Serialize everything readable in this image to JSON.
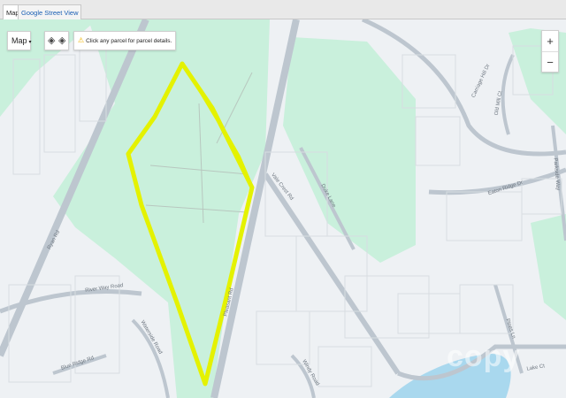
{
  "tabs": [
    {
      "label": "Map",
      "active": true
    },
    {
      "label": "Google Street View",
      "active": false
    }
  ],
  "controls": {
    "map_type_label": "Map",
    "layers_icons": [
      "layer-up-icon",
      "layer-down-icon"
    ],
    "parcel_hint": "Click any parcel for parcel details.",
    "hint_icon": "warning-icon",
    "zoom_in": "+",
    "zoom_out": "−"
  },
  "roads": [
    {
      "name": "Ryan Rd"
    },
    {
      "name": "Pleasant Rd"
    },
    {
      "name": "Vale Crest Rd"
    },
    {
      "name": "River Way Road"
    },
    {
      "name": "Waterside Road"
    },
    {
      "name": "Blue Ridge Rd"
    },
    {
      "name": "Carriage Hill Dr"
    },
    {
      "name": "Eaton Ridge Dr"
    },
    {
      "name": "Old Mill Ct"
    },
    {
      "name": "Parkside Way"
    },
    {
      "name": "Windy Road"
    },
    {
      "name": "Duke Lane"
    },
    {
      "name": "Pines Ln"
    },
    {
      "name": "Lake Ct"
    }
  ],
  "colors": {
    "land": "#eef1f4",
    "green": "#c9f0dc",
    "road": "#bdc6cf",
    "water": "#a9d8ee",
    "parcel_highlight": "#e4f200",
    "lot_line": "#d8dde2"
  },
  "watermark": "copy"
}
